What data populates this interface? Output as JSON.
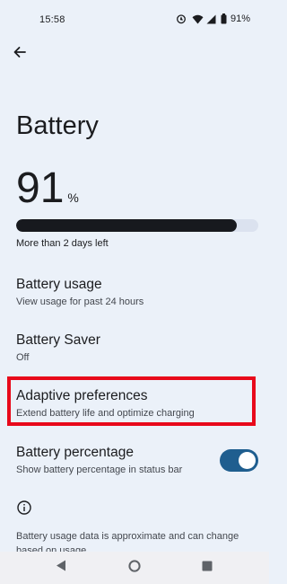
{
  "status_bar": {
    "time": "15:58",
    "battery_percent": "91%",
    "icons": [
      "alarm-icon",
      "wifi-icon",
      "signal-icon",
      "battery-icon"
    ]
  },
  "header": {
    "back_icon": "arrow-back-icon",
    "title": "Battery"
  },
  "battery_level": {
    "value": "91",
    "unit": "%",
    "fill_fraction": 0.91,
    "summary": "More than 2 days left"
  },
  "settings": [
    {
      "title": "Battery usage",
      "subtitle": "View usage for past 24 hours"
    },
    {
      "title": "Battery Saver",
      "subtitle": "Off"
    },
    {
      "title": "Adaptive preferences",
      "subtitle": "Extend battery life and optimize charging"
    },
    {
      "title": "Battery percentage",
      "subtitle": "Show battery percentage in status bar"
    }
  ],
  "battery_percentage_toggle": {
    "on": true
  },
  "highlight": {
    "color": "#e8091b",
    "target": "Adaptive preferences"
  },
  "footer": {
    "info_icon": "info-icon",
    "text": "Battery usage data is approximate and can change based on usage."
  },
  "nav_bar": {
    "icons": [
      "back-triangle-icon",
      "home-circle-icon",
      "recents-square-icon"
    ]
  },
  "colors": {
    "background": "#ebf1f9",
    "bar_fill": "#17191e",
    "bar_track": "#dbe2ef",
    "toggle_on": "#1f5e8f"
  }
}
